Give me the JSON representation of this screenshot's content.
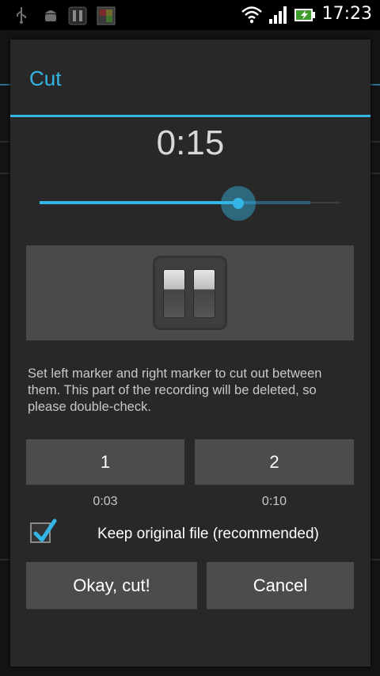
{
  "status_bar": {
    "time": "17:23",
    "icons": [
      "usb-icon",
      "android-debug-icon",
      "pause-notification-icon",
      "app-notification-icon",
      "wifi-icon",
      "signal-icon",
      "battery-charging-icon"
    ]
  },
  "dialog": {
    "title": "Cut",
    "timer": "0:15",
    "seek": {
      "position_fraction": 0.66,
      "buffer_fraction": 0.9
    },
    "description": "Set left marker and right marker to cut out between them. This part of the recording will be deleted, so please double-check.",
    "markers": [
      {
        "label": "1",
        "time": "0:03"
      },
      {
        "label": "2",
        "time": "0:10"
      }
    ],
    "keep_original": {
      "label": "Keep original file (recommended)",
      "checked": true
    },
    "ok_label": "Okay, cut!",
    "cancel_label": "Cancel"
  },
  "colors": {
    "accent": "#33b5e5",
    "dialog_bg": "#282828",
    "button_bg": "#4c4c4c"
  }
}
